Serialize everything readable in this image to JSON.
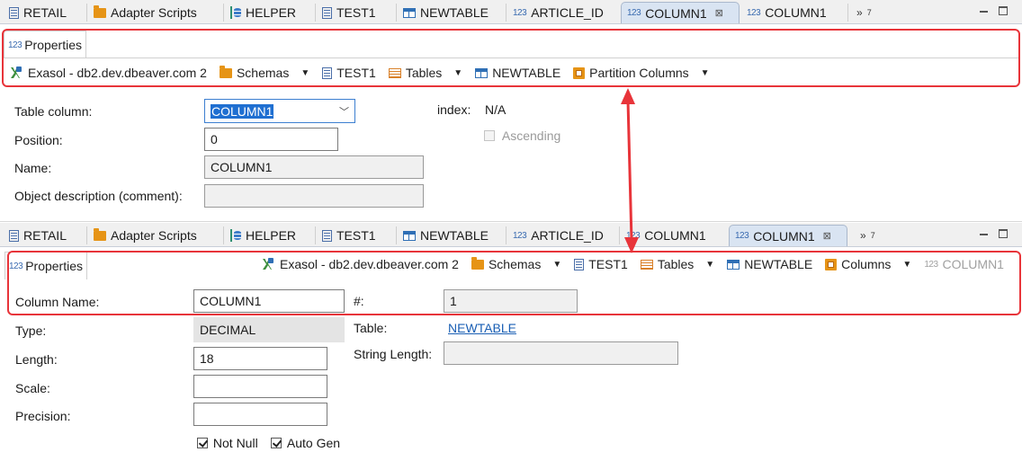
{
  "top": {
    "tabs": [
      {
        "label": "RETAIL",
        "icon": "document-icon"
      },
      {
        "label": "Adapter Scripts",
        "icon": "folder-icon"
      },
      {
        "label": "HELPER",
        "icon": "schema-icon"
      },
      {
        "label": "TEST1",
        "icon": "document-icon"
      },
      {
        "label": "NEWTABLE",
        "icon": "table-icon"
      },
      {
        "label": "ARTICLE_ID",
        "icon": "column-123-icon"
      },
      {
        "label": "COLUMN1",
        "icon": "column-123-icon",
        "active": true
      },
      {
        "label": "COLUMN1",
        "icon": "column-123-icon"
      }
    ],
    "overflow_count": "7",
    "properties_tab": "Properties",
    "breadcrumb": [
      {
        "label": "Exasol - db2.dev.dbeaver.com 2",
        "icon": "connection-icon"
      },
      {
        "label": "Schemas",
        "icon": "folder-icon",
        "dropdown": true
      },
      {
        "label": "TEST1",
        "icon": "document-icon"
      },
      {
        "label": "Tables",
        "icon": "tables-icon",
        "dropdown": true
      },
      {
        "label": "NEWTABLE",
        "icon": "table-icon"
      },
      {
        "label": "Partition Columns",
        "icon": "partition-columns-icon",
        "dropdown": true
      }
    ],
    "form": {
      "table_column_label": "Table column:",
      "table_column_value": "COLUMN1",
      "position_label": "Position:",
      "position_value": "0",
      "name_label": "Name:",
      "name_value": "COLUMN1",
      "description_label": "Object description (comment):",
      "description_value": "",
      "index_label": "index:",
      "index_value": "N/A",
      "ascending_label": "Ascending"
    }
  },
  "bottom": {
    "tabs": [
      {
        "label": "RETAIL",
        "icon": "document-icon"
      },
      {
        "label": "Adapter Scripts",
        "icon": "folder-icon"
      },
      {
        "label": "HELPER",
        "icon": "schema-icon"
      },
      {
        "label": "TEST1",
        "icon": "document-icon"
      },
      {
        "label": "NEWTABLE",
        "icon": "table-icon"
      },
      {
        "label": "ARTICLE_ID",
        "icon": "column-123-icon"
      },
      {
        "label": "COLUMN1",
        "icon": "column-123-icon"
      },
      {
        "label": "COLUMN1",
        "icon": "column-123-icon",
        "active": true
      }
    ],
    "overflow_count": "7",
    "properties_tab": "Properties",
    "breadcrumb": [
      {
        "label": "Exasol - db2.dev.dbeaver.com 2",
        "icon": "connection-icon"
      },
      {
        "label": "Schemas",
        "icon": "folder-icon",
        "dropdown": true
      },
      {
        "label": "TEST1",
        "icon": "document-icon"
      },
      {
        "label": "Tables",
        "icon": "tables-icon",
        "dropdown": true
      },
      {
        "label": "NEWTABLE",
        "icon": "table-icon"
      },
      {
        "label": "Columns",
        "icon": "folder-icon",
        "dropdown": true
      },
      {
        "label": "COLUMN1",
        "icon": "column-123-icon",
        "disabled": true
      }
    ],
    "form": {
      "column_name_label": "Column Name:",
      "column_name_value": "COLUMN1",
      "ordinal_label": "#:",
      "ordinal_value": "1",
      "type_label": "Type:",
      "type_value": "DECIMAL",
      "table_label": "Table:",
      "table_value": "NEWTABLE",
      "length_label": "Length:",
      "length_value": "18",
      "string_length_label": "String Length:",
      "string_length_value": "",
      "scale_label": "Scale:",
      "scale_value": "",
      "precision_label": "Precision:",
      "precision_value": "",
      "not_null_label": "Not Null",
      "auto_gen_label": "Auto Gen"
    }
  },
  "number_icon_text": "123",
  "colors": {
    "highlight": "#e8343a",
    "accent": "#1a5fb4",
    "active_tab": "#d9e4f2"
  }
}
